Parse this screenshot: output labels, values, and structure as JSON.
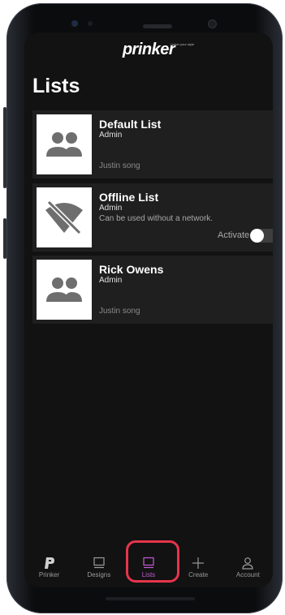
{
  "app": {
    "logo_text": "prinker",
    "logo_tagline": "Linker your style"
  },
  "page": {
    "title": "Lists"
  },
  "lists": [
    {
      "title": "Default List",
      "role": "Admin",
      "description": "",
      "owner": "Justin song",
      "icon": "group-icon"
    },
    {
      "title": "Offline List",
      "role": "Admin",
      "description": "Can be used without a network.",
      "owner": "",
      "icon": "wifi-off-icon",
      "toggle_label": "Activate",
      "toggle_on": false
    },
    {
      "title": "Rick Owens",
      "role": "Admin",
      "description": "",
      "owner": "Justin song",
      "icon": "group-icon"
    }
  ],
  "nav": {
    "items": [
      {
        "label": "Prinker",
        "icon": "prinker-logo-icon"
      },
      {
        "label": "Designs",
        "icon": "designs-icon"
      },
      {
        "label": "Lists",
        "icon": "lists-icon",
        "active": true
      },
      {
        "label": "Create",
        "icon": "plus-icon"
      },
      {
        "label": "Account",
        "icon": "account-icon"
      }
    ]
  },
  "colors": {
    "accent": "#c35bd4",
    "highlight": "#e8344c",
    "background": "#121212",
    "card": "#1f1f1f"
  }
}
